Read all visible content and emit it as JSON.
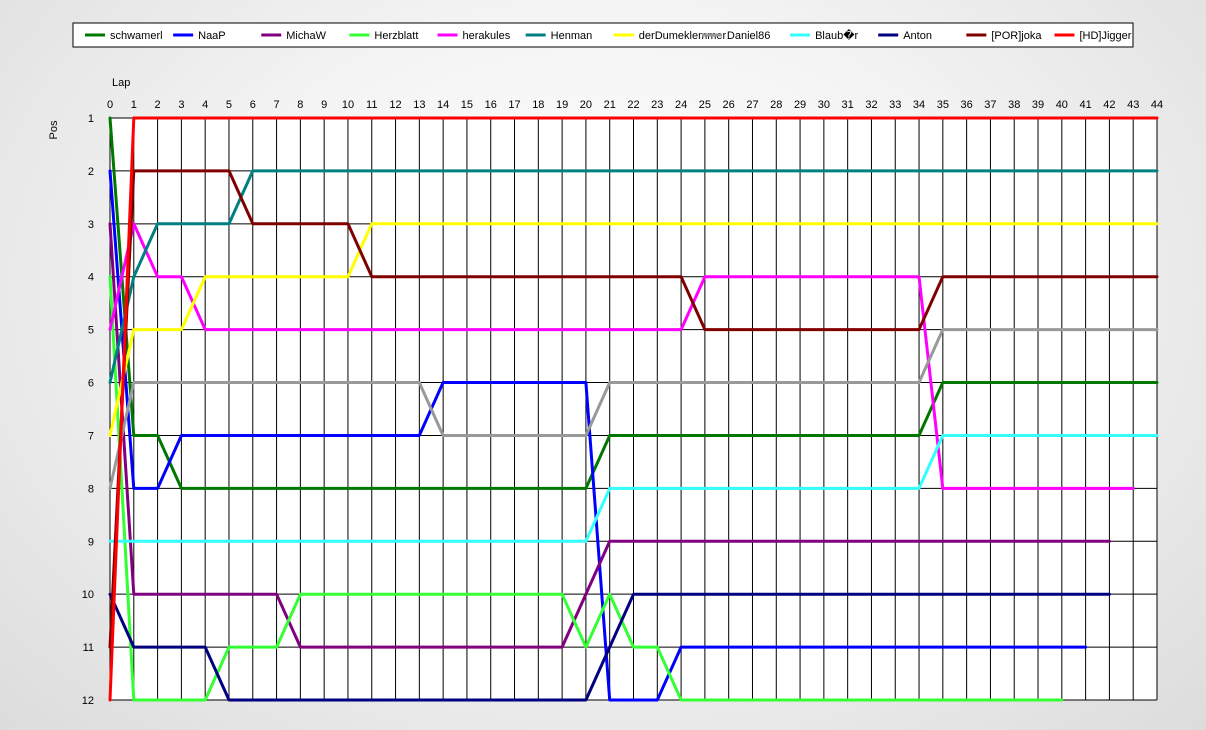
{
  "chart_data": {
    "type": "line",
    "xlabel": "Lap",
    "ylabel": "Pos",
    "xlim": [
      0,
      44
    ],
    "ylim": [
      1,
      12
    ],
    "y_inverted": true,
    "grid": true,
    "legend_position": "top",
    "x_ticks": [
      0,
      1,
      2,
      3,
      4,
      5,
      6,
      7,
      8,
      9,
      10,
      11,
      12,
      13,
      14,
      15,
      16,
      17,
      18,
      19,
      20,
      21,
      22,
      23,
      24,
      25,
      26,
      27,
      28,
      29,
      30,
      31,
      32,
      33,
      34,
      35,
      36,
      37,
      38,
      39,
      40,
      41,
      42,
      43,
      44
    ],
    "y_ticks": [
      1,
      2,
      3,
      4,
      5,
      6,
      7,
      8,
      9,
      10,
      11,
      12
    ],
    "series": [
      {
        "name": "schwamerl",
        "color": "#007800",
        "points": [
          [
            0,
            1
          ],
          [
            1,
            7
          ],
          [
            2,
            7
          ],
          [
            3,
            8
          ],
          [
            20,
            8
          ],
          [
            21,
            7
          ],
          [
            34,
            7
          ],
          [
            35,
            6
          ],
          [
            44,
            6
          ]
        ]
      },
      {
        "name": "NaaP",
        "color": "#0000ff",
        "points": [
          [
            0,
            2
          ],
          [
            1,
            8
          ],
          [
            2,
            8
          ],
          [
            3,
            7
          ],
          [
            13,
            7
          ],
          [
            14,
            6
          ],
          [
            20,
            6
          ],
          [
            21,
            12
          ],
          [
            23,
            12
          ],
          [
            24,
            11
          ],
          [
            41,
            11
          ]
        ]
      },
      {
        "name": "MichaW",
        "color": "#800080",
        "points": [
          [
            0,
            3
          ],
          [
            1,
            10
          ],
          [
            7,
            10
          ],
          [
            8,
            11
          ],
          [
            19,
            11
          ],
          [
            21,
            9
          ],
          [
            42,
            9
          ]
        ]
      },
      {
        "name": "Herzblatt",
        "color": "#33ff33",
        "points": [
          [
            0,
            4
          ],
          [
            1,
            12
          ],
          [
            4,
            12
          ],
          [
            5,
            11
          ],
          [
            7,
            11
          ],
          [
            8,
            10
          ],
          [
            19,
            10
          ],
          [
            20,
            11
          ],
          [
            21,
            10
          ],
          [
            22,
            11
          ],
          [
            23,
            11
          ],
          [
            24,
            12
          ],
          [
            40,
            12
          ]
        ]
      },
      {
        "name": "herakules",
        "color": "#ff00ff",
        "points": [
          [
            0,
            5
          ],
          [
            1,
            3
          ],
          [
            2,
            4
          ],
          [
            3,
            4
          ],
          [
            4,
            5
          ],
          [
            24,
            5
          ],
          [
            25,
            4
          ],
          [
            34,
            4
          ],
          [
            35,
            8
          ],
          [
            43,
            8
          ]
        ]
      },
      {
        "name": "Henman",
        "color": "#008080",
        "points": [
          [
            0,
            6
          ],
          [
            1,
            4
          ],
          [
            2,
            3
          ],
          [
            5,
            3
          ],
          [
            6,
            2
          ],
          [
            44,
            2
          ]
        ]
      },
      {
        "name": "derDumeklemmer",
        "color": "#ffff00",
        "points": [
          [
            0,
            7
          ],
          [
            1,
            5
          ],
          [
            3,
            5
          ],
          [
            4,
            4
          ],
          [
            10,
            4
          ],
          [
            11,
            3
          ],
          [
            44,
            3
          ]
        ]
      },
      {
        "name": "Daniel86",
        "color": "#999999",
        "points": [
          [
            0,
            8
          ],
          [
            1,
            6
          ],
          [
            13,
            6
          ],
          [
            14,
            7
          ],
          [
            20,
            7
          ],
          [
            21,
            6
          ],
          [
            34,
            6
          ],
          [
            35,
            5
          ],
          [
            44,
            5
          ]
        ]
      },
      {
        "name": "Blaub�r",
        "color": "#33ffff",
        "points": [
          [
            0,
            9
          ],
          [
            1,
            9
          ],
          [
            20,
            9
          ],
          [
            21,
            8
          ],
          [
            34,
            8
          ],
          [
            35,
            7
          ],
          [
            44,
            7
          ]
        ]
      },
      {
        "name": "Anton",
        "color": "#000080",
        "points": [
          [
            0,
            10
          ],
          [
            1,
            11
          ],
          [
            4,
            11
          ],
          [
            5,
            12
          ],
          [
            20,
            12
          ],
          [
            22,
            10
          ],
          [
            42,
            10
          ]
        ]
      },
      {
        "name": "[POR]joka",
        "color": "#800000",
        "points": [
          [
            0,
            11
          ],
          [
            1,
            2
          ],
          [
            5,
            2
          ],
          [
            6,
            3
          ],
          [
            10,
            3
          ],
          [
            11,
            4
          ],
          [
            24,
            4
          ],
          [
            25,
            5
          ],
          [
            34,
            5
          ],
          [
            35,
            4
          ],
          [
            44,
            4
          ]
        ]
      },
      {
        "name": "[HD]Jigger",
        "color": "#ff0000",
        "points": [
          [
            0,
            12
          ],
          [
            1,
            1
          ],
          [
            44,
            1
          ]
        ]
      }
    ]
  }
}
